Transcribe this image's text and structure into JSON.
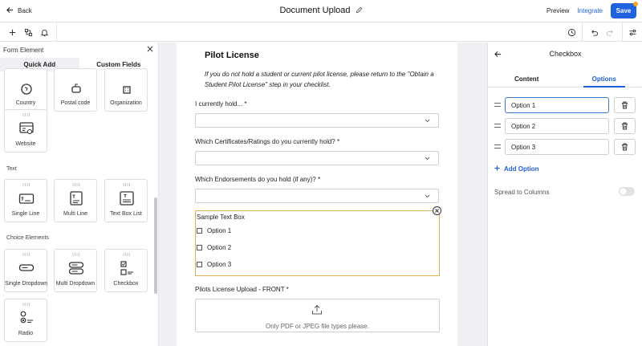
{
  "topbar": {
    "back_label": "Back",
    "document_title": "Document Upload",
    "preview_label": "Preview",
    "integrate_label": "Integrate",
    "save_label": "Save",
    "accent_color": "#1f62e0"
  },
  "toolbar": {
    "left_icons": [
      "plus-icon",
      "grid-icon",
      "bell-icon"
    ],
    "right_icons": [
      "history-icon",
      "undo-icon",
      "redo-icon",
      "settings-sliders-icon"
    ]
  },
  "left_panel": {
    "title": "Form Element",
    "tabs": [
      "Quick Add",
      "Custom Fields"
    ],
    "active_tab": "Quick Add",
    "elements_top": [
      {
        "label": "Country",
        "icon": "globe-icon"
      },
      {
        "label": "Postal code",
        "icon": "mailbox-icon"
      },
      {
        "label": "Organization",
        "icon": "building-icon"
      }
    ],
    "website": {
      "label": "Website",
      "icon": "website-icon"
    },
    "text_section": "Text",
    "text_elements": [
      {
        "label": "Single Line",
        "icon": "single-line-icon"
      },
      {
        "label": "Multi Line",
        "icon": "multi-line-icon"
      },
      {
        "label": "Text Box List",
        "icon": "text-box-list-icon"
      }
    ],
    "choice_section": "Choice Elements",
    "choice_elements": [
      {
        "label": "Single Dropdown",
        "icon": "dropdown-icon"
      },
      {
        "label": "Multi Dropdown",
        "icon": "multi-dropdown-icon"
      },
      {
        "label": "Checkbox",
        "icon": "checkbox-icon"
      }
    ],
    "radio": {
      "label": "Radio",
      "icon": "radio-icon"
    }
  },
  "form": {
    "title": "Pilot License",
    "intro": "If you do not hold a student or current pilot license, please return to the \"Obtain a Student Pilot License\" step in your checklist.",
    "q1": "I currently hold... *",
    "q2": "Which Certificates/Ratings do you currently hold? *",
    "q3": "Which Endorsements do you hold (if any)? *",
    "text_box_title": "Sample Text Box",
    "box_options": [
      "Option 1",
      "Option 2",
      "Option 3"
    ],
    "upload_label": "Pilots License Upload - FRONT *",
    "upload_hint": "Only PDF or JPEG file types please.",
    "selected_border_color": "#e0b054"
  },
  "right_panel": {
    "title": "Checkbox",
    "tabs": [
      "Content",
      "Options"
    ],
    "active_tab": "Options",
    "options": [
      "Option 1",
      "Option 2",
      "Option 3"
    ],
    "add_option_label": "Add Option",
    "spread_label": "Spread to Columns",
    "spread_enabled": false
  }
}
